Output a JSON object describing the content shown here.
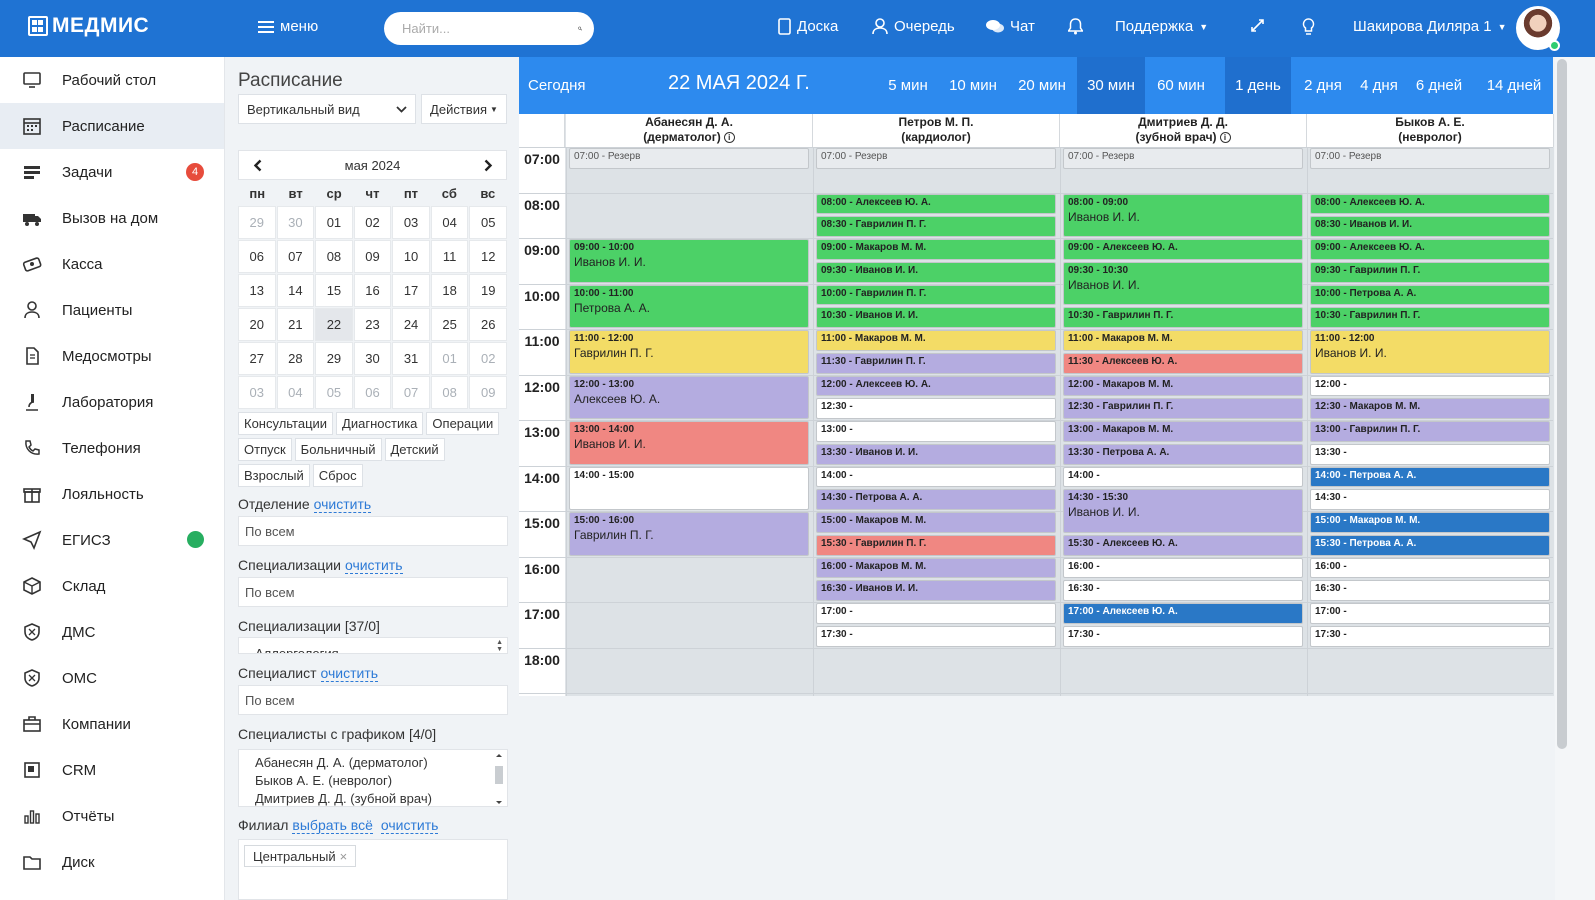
{
  "topbar": {
    "logo": "МЕДМИС",
    "menu_label": "меню",
    "search_placeholder": "Найти...",
    "nav": {
      "board": "Доска",
      "queue": "Очередь",
      "chat": "Чат",
      "support": "Поддержка",
      "user": "Шакирова Диляра 1"
    }
  },
  "sidebar": {
    "items": [
      {
        "label": "Рабочий стол",
        "icon": "desktop-icon"
      },
      {
        "label": "Расписание",
        "icon": "calendar-icon",
        "active": true
      },
      {
        "label": "Задачи",
        "icon": "tasks-icon",
        "badge": "4"
      },
      {
        "label": "Вызов на дом",
        "icon": "ambulance-icon"
      },
      {
        "label": "Касса",
        "icon": "cash-icon"
      },
      {
        "label": "Пациенты",
        "icon": "patients-icon"
      },
      {
        "label": "Медосмотры",
        "icon": "document-icon"
      },
      {
        "label": "Лаборатория",
        "icon": "microscope-icon"
      },
      {
        "label": "Телефония",
        "icon": "phone-icon"
      },
      {
        "label": "Лояльность",
        "icon": "gift-icon"
      },
      {
        "label": "ЕГИСЗ",
        "icon": "send-icon",
        "status": "online"
      },
      {
        "label": "Склад",
        "icon": "box-icon"
      },
      {
        "label": "ДМС",
        "icon": "shield-icon"
      },
      {
        "label": "ОМС",
        "icon": "shield-icon"
      },
      {
        "label": "Компании",
        "icon": "briefcase-icon"
      },
      {
        "label": "CRM",
        "icon": "crm-icon"
      },
      {
        "label": "Отчёты",
        "icon": "chart-icon"
      },
      {
        "label": "Диск",
        "icon": "folder-icon"
      }
    ]
  },
  "panel": {
    "title": "Расписание",
    "view_select": "Вертикальный вид",
    "actions": "Действия",
    "calendar": {
      "month_label": "мая 2024",
      "dow": [
        "пн",
        "вт",
        "ср",
        "чт",
        "пт",
        "сб",
        "вс"
      ],
      "days": [
        {
          "d": "29",
          "o": true
        },
        {
          "d": "30",
          "o": true
        },
        {
          "d": "01"
        },
        {
          "d": "02"
        },
        {
          "d": "03"
        },
        {
          "d": "04"
        },
        {
          "d": "05"
        },
        {
          "d": "06"
        },
        {
          "d": "07"
        },
        {
          "d": "08"
        },
        {
          "d": "09"
        },
        {
          "d": "10"
        },
        {
          "d": "11"
        },
        {
          "d": "12"
        },
        {
          "d": "13"
        },
        {
          "d": "14"
        },
        {
          "d": "15"
        },
        {
          "d": "16"
        },
        {
          "d": "17"
        },
        {
          "d": "18"
        },
        {
          "d": "19"
        },
        {
          "d": "20"
        },
        {
          "d": "21"
        },
        {
          "d": "22",
          "s": true
        },
        {
          "d": "23"
        },
        {
          "d": "24"
        },
        {
          "d": "25"
        },
        {
          "d": "26"
        },
        {
          "d": "27"
        },
        {
          "d": "28"
        },
        {
          "d": "29"
        },
        {
          "d": "30"
        },
        {
          "d": "31"
        },
        {
          "d": "01",
          "o": true
        },
        {
          "d": "02",
          "o": true
        },
        {
          "d": "03",
          "o": true
        },
        {
          "d": "04",
          "o": true
        },
        {
          "d": "05",
          "o": true
        },
        {
          "d": "06",
          "o": true
        },
        {
          "d": "07",
          "o": true
        },
        {
          "d": "08",
          "o": true
        },
        {
          "d": "09",
          "o": true
        }
      ]
    },
    "tags": [
      "Консультации",
      "Диагностика",
      "Операции",
      "Отпуск",
      "Больничный",
      "Детский",
      "Взрослый",
      "Сброс"
    ],
    "filters": {
      "department_label": "Отделение",
      "clear": "очистить",
      "select_all": "выбрать всё",
      "all_placeholder": "По всем",
      "spec_label": "Специализации",
      "spec_count_label": "Специализации [37/0]",
      "spec_truncated": "Аллергология",
      "specialist_label": "Специалист",
      "sched_label": "Специалисты с графиком [4/0]",
      "sched_list": [
        "Абанесян Д. А. (дерматолог)",
        "Быков А. Е. (невролог)",
        "Дмитриев Д. Д. (зубной врач)"
      ],
      "branch_label": "Филиал",
      "branch_chip": "Центральный"
    }
  },
  "schedule": {
    "today": "Сегодня",
    "date": "22 МАЯ 2024 Г.",
    "intervals": [
      "5 мин",
      "10 мин",
      "20 мин",
      "30 мин",
      "60 мин"
    ],
    "interval_active": "30 мин",
    "ranges": [
      "1 день",
      "2 дня",
      "4 дня",
      "6 дней",
      "14 дней"
    ],
    "range_active": "1 день",
    "hours": [
      "07:00",
      "08:00",
      "09:00",
      "10:00",
      "11:00",
      "12:00",
      "13:00",
      "14:00",
      "15:00",
      "16:00",
      "17:00",
      "18:00"
    ],
    "colors": {
      "green": "#4cd167",
      "yellow": "#f3dc66",
      "purple": "#b4ace0",
      "red": "#f08782",
      "blue": "#2a78c6",
      "white": "#ffffff",
      "reserve": "#e8ebee"
    },
    "doctors": [
      {
        "name": "Абанесян Д. А.",
        "spec": "(дерматолог)",
        "info": true,
        "events": [
          {
            "start": "07:00",
            "end": "07:30",
            "text": "07:00 - Резерв",
            "c": "reserve"
          },
          {
            "start": "09:00",
            "end": "10:00",
            "text": "09:00 - 10:00",
            "name": "Иванов И. И.",
            "c": "green"
          },
          {
            "start": "10:00",
            "end": "11:00",
            "text": "10:00 - 11:00",
            "name": "Петрова А. А.",
            "c": "green"
          },
          {
            "start": "11:00",
            "end": "12:00",
            "text": "11:00 - 12:00",
            "name": "Гаврилин П. Г.",
            "c": "yellow"
          },
          {
            "start": "12:00",
            "end": "13:00",
            "text": "12:00 - 13:00",
            "name": "Алексеев Ю. А.",
            "c": "purple"
          },
          {
            "start": "13:00",
            "end": "14:00",
            "text": "13:00 - 14:00",
            "name": "Иванов И. И.",
            "c": "red"
          },
          {
            "start": "14:00",
            "end": "15:00",
            "text": "14:00 - 15:00",
            "c": "white"
          },
          {
            "start": "15:00",
            "end": "16:00",
            "text": "15:00 - 16:00",
            "name": "Гаврилин П. Г.",
            "c": "purple"
          }
        ]
      },
      {
        "name": "Петров М. П.",
        "spec": "(кардиолог)",
        "info": false,
        "events": [
          {
            "start": "07:00",
            "end": "07:30",
            "text": "07:00 - Резерв",
            "c": "reserve"
          },
          {
            "start": "08:00",
            "end": "08:30",
            "text": "08:00 - Алексеев Ю. А.",
            "c": "green"
          },
          {
            "start": "08:30",
            "end": "09:00",
            "text": "08:30 - Гаврилин П. Г.",
            "c": "green"
          },
          {
            "start": "09:00",
            "end": "09:30",
            "text": "09:00 - Макаров М. М.",
            "c": "green"
          },
          {
            "start": "09:30",
            "end": "10:00",
            "text": "09:30 - Иванов И. И.",
            "c": "green"
          },
          {
            "start": "10:00",
            "end": "10:30",
            "text": "10:00 - Гаврилин П. Г.",
            "c": "green"
          },
          {
            "start": "10:30",
            "end": "11:00",
            "text": "10:30 - Иванов И. И.",
            "c": "green"
          },
          {
            "start": "11:00",
            "end": "11:30",
            "text": "11:00 - Макаров М. М.",
            "c": "yellow"
          },
          {
            "start": "11:30",
            "end": "12:00",
            "text": "11:30 - Гаврилин П. Г.",
            "c": "purple"
          },
          {
            "start": "12:00",
            "end": "12:30",
            "text": "12:00 - Алексеев Ю. А.",
            "c": "purple"
          },
          {
            "start": "12:30",
            "end": "13:00",
            "text": "12:30 -",
            "c": "white"
          },
          {
            "start": "13:00",
            "end": "13:30",
            "text": "13:00 -",
            "c": "white"
          },
          {
            "start": "13:30",
            "end": "14:00",
            "text": "13:30 - Иванов И. И.",
            "c": "purple"
          },
          {
            "start": "14:00",
            "end": "14:30",
            "text": "14:00 -",
            "c": "white"
          },
          {
            "start": "14:30",
            "end": "15:00",
            "text": "14:30 - Петрова А. А.",
            "c": "purple"
          },
          {
            "start": "15:00",
            "end": "15:30",
            "text": "15:00 - Макаров М. М.",
            "c": "purple"
          },
          {
            "start": "15:30",
            "end": "16:00",
            "text": "15:30 - Гаврилин П. Г.",
            "c": "red"
          },
          {
            "start": "16:00",
            "end": "16:30",
            "text": "16:00 - Макаров М. М.",
            "c": "purple"
          },
          {
            "start": "16:30",
            "end": "17:00",
            "text": "16:30 - Иванов И. И.",
            "c": "purple"
          },
          {
            "start": "17:00",
            "end": "17:30",
            "text": "17:00 -",
            "c": "white"
          },
          {
            "start": "17:30",
            "end": "18:00",
            "text": "17:30 -",
            "c": "white"
          }
        ]
      },
      {
        "name": "Дмитриев Д. Д.",
        "spec": "(зубной врач)",
        "info": true,
        "events": [
          {
            "start": "07:00",
            "end": "07:30",
            "text": "07:00 - Резерв",
            "c": "reserve"
          },
          {
            "start": "08:00",
            "end": "09:00",
            "text": "08:00 - 09:00",
            "name": "Иванов И. И.",
            "c": "green"
          },
          {
            "start": "09:00",
            "end": "09:30",
            "text": "09:00 - Алексеев Ю. А.",
            "c": "green"
          },
          {
            "start": "09:30",
            "end": "10:30",
            "text": "09:30 - 10:30",
            "name": "Иванов И. И.",
            "c": "green"
          },
          {
            "start": "10:30",
            "end": "11:00",
            "text": "10:30 - Гаврилин П. Г.",
            "c": "green"
          },
          {
            "start": "11:00",
            "end": "11:30",
            "text": "11:00 - Макаров М. М.",
            "c": "yellow"
          },
          {
            "start": "11:30",
            "end": "12:00",
            "text": "11:30 - Алексеев Ю. А.",
            "c": "red"
          },
          {
            "start": "12:00",
            "end": "12:30",
            "text": "12:00 - Макаров М. М.",
            "c": "purple"
          },
          {
            "start": "12:30",
            "end": "13:00",
            "text": "12:30 - Гаврилин П. Г.",
            "c": "purple"
          },
          {
            "start": "13:00",
            "end": "13:30",
            "text": "13:00 - Макаров М. М.",
            "c": "purple"
          },
          {
            "start": "13:30",
            "end": "14:00",
            "text": "13:30 - Петрова А. А.",
            "c": "purple"
          },
          {
            "start": "14:00",
            "end": "14:30",
            "text": "14:00 -",
            "c": "white"
          },
          {
            "start": "14:30",
            "end": "15:30",
            "text": "14:30 - 15:30",
            "name": "Иванов И. И.",
            "c": "purple"
          },
          {
            "start": "15:30",
            "end": "16:00",
            "text": "15:30 - Алексеев Ю. А.",
            "c": "purple"
          },
          {
            "start": "16:00",
            "end": "16:30",
            "text": "16:00 -",
            "c": "white"
          },
          {
            "start": "16:30",
            "end": "17:00",
            "text": "16:30 -",
            "c": "white"
          },
          {
            "start": "17:00",
            "end": "17:30",
            "text": "17:00 - Алексеев Ю. А.",
            "c": "blue"
          },
          {
            "start": "17:30",
            "end": "18:00",
            "text": "17:30 -",
            "c": "white"
          }
        ]
      },
      {
        "name": "Быков А. Е.",
        "spec": "(невролог)",
        "info": false,
        "events": [
          {
            "start": "07:00",
            "end": "07:30",
            "text": "07:00 - Резерв",
            "c": "reserve"
          },
          {
            "start": "08:00",
            "end": "08:30",
            "text": "08:00 - Алексеев Ю. А.",
            "c": "green"
          },
          {
            "start": "08:30",
            "end": "09:00",
            "text": "08:30 - Иванов И. И.",
            "c": "green"
          },
          {
            "start": "09:00",
            "end": "09:30",
            "text": "09:00 - Алексеев Ю. А.",
            "c": "green"
          },
          {
            "start": "09:30",
            "end": "10:00",
            "text": "09:30 - Гаврилин П. Г.",
            "c": "green"
          },
          {
            "start": "10:00",
            "end": "10:30",
            "text": "10:00 - Петрова А. А.",
            "c": "green"
          },
          {
            "start": "10:30",
            "end": "11:00",
            "text": "10:30 - Гаврилин П. Г.",
            "c": "green"
          },
          {
            "start": "11:00",
            "end": "12:00",
            "text": "11:00 - 12:00",
            "name": "Иванов И. И.",
            "c": "yellow"
          },
          {
            "start": "12:00",
            "end": "12:30",
            "text": "12:00 -",
            "c": "white"
          },
          {
            "start": "12:30",
            "end": "13:00",
            "text": "12:30 - Макаров М. М.",
            "c": "purple"
          },
          {
            "start": "13:00",
            "end": "13:30",
            "text": "13:00 - Гаврилин П. Г.",
            "c": "purple"
          },
          {
            "start": "13:30",
            "end": "14:00",
            "text": "13:30 -",
            "c": "white"
          },
          {
            "start": "14:00",
            "end": "14:30",
            "text": "14:00 - Петрова А. А.",
            "c": "blue"
          },
          {
            "start": "14:30",
            "end": "15:00",
            "text": "14:30 -",
            "c": "white"
          },
          {
            "start": "15:00",
            "end": "15:30",
            "text": "15:00 - Макаров М. М.",
            "c": "blue"
          },
          {
            "start": "15:30",
            "end": "16:00",
            "text": "15:30 - Петрова А. А.",
            "c": "blue"
          },
          {
            "start": "16:00",
            "end": "16:30",
            "text": "16:00 -",
            "c": "white"
          },
          {
            "start": "16:30",
            "end": "17:00",
            "text": "16:30 -",
            "c": "white"
          },
          {
            "start": "17:00",
            "end": "17:30",
            "text": "17:00 -",
            "c": "white"
          },
          {
            "start": "17:30",
            "end": "18:00",
            "text": "17:30 -",
            "c": "white"
          }
        ]
      }
    ]
  }
}
